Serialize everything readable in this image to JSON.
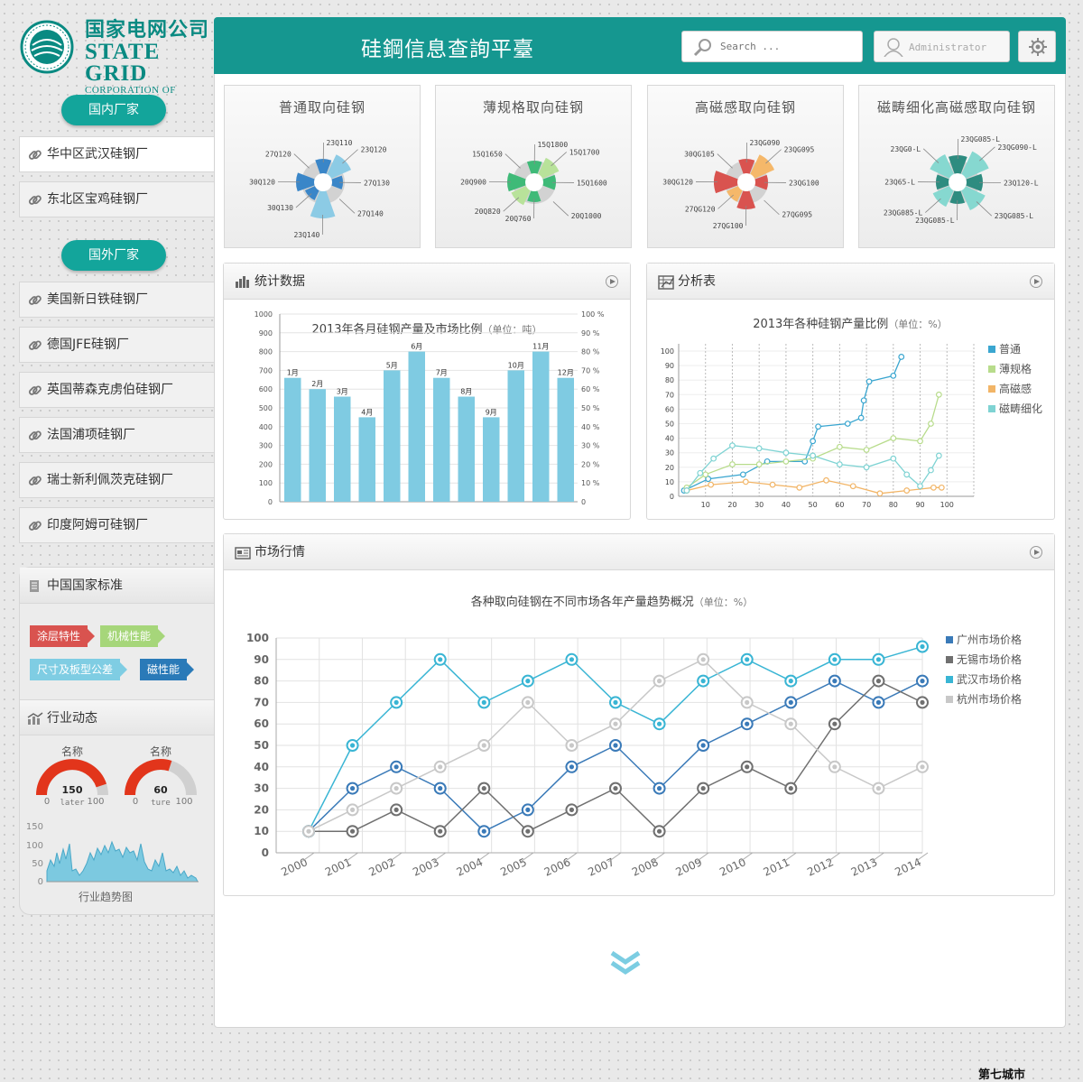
{
  "logo": {
    "cn": "国家电网公司",
    "en1": "STATE GRID",
    "en2": "CORPORATION OF CHINA"
  },
  "app": {
    "title": "硅鋼信息查詢平臺"
  },
  "header": {
    "search_placeholder": "Search ...",
    "user": "Administrator"
  },
  "sidebar": {
    "domestic_label": "国内厂家",
    "domestic": [
      {
        "label": "华中区武汉硅钢厂"
      },
      {
        "label": "东北区宝鸡硅钢厂"
      }
    ],
    "foreign_label": "国外厂家",
    "foreign": [
      {
        "label": "美国新日铁硅钢厂"
      },
      {
        "label": "德国JFE硅钢厂"
      },
      {
        "label": "英国蒂森克虏伯硅钢厂"
      },
      {
        "label": "法国浦项硅钢厂"
      },
      {
        "label": "瑞士新利佩茨克硅钢厂"
      },
      {
        "label": "印度阿姆可硅钢厂"
      }
    ],
    "standards_title": "中国国家标准",
    "tags": [
      {
        "label": "涂层特性",
        "color": "#d9534f"
      },
      {
        "label": "机械性能",
        "color": "#a6d67a"
      },
      {
        "label": "尺寸及板型公差",
        "color": "#7fcde3"
      },
      {
        "label": "磁性能",
        "color": "#2a7ab8"
      }
    ],
    "news_title": "行业动态",
    "gauges": [
      {
        "name": "名称",
        "value": "150",
        "min": "0",
        "max": "100",
        "sub": "later",
        "fill": 0.9
      },
      {
        "name": "名称",
        "value": "60",
        "min": "0",
        "max": "100",
        "sub": "ture",
        "fill": 0.6
      }
    ],
    "mini_chart": {
      "label": "行业趋势图",
      "yticks": [
        "150",
        "100",
        "50",
        "0"
      ]
    }
  },
  "cards": [
    {
      "title": "普通取向硅钢",
      "color": "#3a86c8",
      "labels": [
        "23Q110",
        "23Q120",
        "27Q130",
        "27Q140",
        "23Q140",
        "30Q130",
        "30Q120",
        "27Q120"
      ]
    },
    {
      "title": "薄规格取向硅钢",
      "color": "#3fba78",
      "light": "#b8e29a",
      "labels": [
        "15Q1800",
        "15Q1700",
        "15Q1600",
        "20Q1000",
        "20Q760",
        "20Q820",
        "20Q900",
        "15Q1650"
      ]
    },
    {
      "title": "高磁感取向硅钢",
      "color": "#d9534f",
      "light": "#f5b86a",
      "labels": [
        "23QG090",
        "23QG095",
        "23QG100",
        "27QG095",
        "27QG100",
        "27QG120",
        "30QG120",
        "30QG105"
      ]
    },
    {
      "title": "磁畴细化高磁感取向硅钢",
      "color": "#2e8c80",
      "light": "#86d8d0",
      "labels": [
        "23QG085-L",
        "23QG090-L",
        "23Q120-L",
        "23QG085-L",
        "23QG085-L",
        "23QG085-L",
        "23Q65-L",
        "23QG0-L"
      ]
    }
  ],
  "stats_panel": {
    "title": "统计数据"
  },
  "analysis_panel": {
    "title": "分析表"
  },
  "market_panel": {
    "title": "市场行情"
  },
  "chart_data": [
    {
      "type": "bar",
      "title": "2013年各月硅钢产量及市场比例",
      "unit": "（单位：吨）",
      "categories": [
        "1月",
        "2月",
        "3月",
        "4月",
        "5月",
        "6月",
        "7月",
        "8月",
        "9月",
        "10月",
        "11月",
        "12月"
      ],
      "values": [
        660,
        600,
        560,
        450,
        700,
        800,
        660,
        560,
        450,
        700,
        800,
        660
      ],
      "ylim": [
        0,
        1000
      ],
      "yticks": [
        "1000",
        "900",
        "800",
        "700",
        "600",
        "500",
        "400",
        "300",
        "200",
        "100",
        "0"
      ],
      "y2ticks": [
        "100 %",
        "90 %",
        "80 %",
        "70 %",
        "60 %",
        "50 %",
        "40 %",
        "30 %",
        "20 %",
        "10 %",
        "0"
      ],
      "color": "#7fcbe2"
    },
    {
      "type": "line",
      "title": "2013年各种硅钢产量比例",
      "unit": "（单位：%）",
      "xticks": [
        "10",
        "20",
        "30",
        "40",
        "50",
        "60",
        "70",
        "80",
        "90",
        "100"
      ],
      "yticks": [
        "100",
        "90",
        "80",
        "70",
        "60",
        "50",
        "40",
        "30",
        "20",
        "10",
        "0"
      ],
      "xlim": [
        0,
        110
      ],
      "ylim": [
        0,
        100
      ],
      "series": [
        {
          "name": "普通",
          "color": "#3aa6d0",
          "x": [
            2,
            11,
            24,
            33,
            47,
            50,
            52,
            63,
            68,
            69,
            71,
            80,
            83
          ],
          "y": [
            4,
            12,
            15,
            24,
            24,
            38,
            48,
            50,
            54,
            66,
            79,
            83,
            96
          ]
        },
        {
          "name": "薄规格",
          "color": "#b8dc8c",
          "x": [
            3,
            10,
            20,
            30,
            40,
            50,
            60,
            70,
            80,
            90,
            94,
            97
          ],
          "y": [
            6,
            15,
            22,
            22,
            24,
            26,
            34,
            32,
            40,
            38,
            50,
            70
          ]
        },
        {
          "name": "高磁感",
          "color": "#f2b567",
          "x": [
            3,
            12,
            25,
            35,
            45,
            55,
            65,
            75,
            85,
            95,
            98
          ],
          "y": [
            4,
            8,
            10,
            8,
            6,
            11,
            7,
            2,
            4,
            6,
            6
          ]
        },
        {
          "name": "磁畴细化",
          "color": "#7fd3d3",
          "x": [
            3,
            8,
            13,
            20,
            30,
            40,
            50,
            60,
            70,
            80,
            85,
            90,
            94,
            97
          ],
          "y": [
            4,
            16,
            26,
            35,
            33,
            30,
            28,
            22,
            20,
            26,
            15,
            7,
            18,
            28
          ]
        }
      ]
    },
    {
      "type": "line",
      "title": "各种取向硅钢在不同市场各年产量趋势概况",
      "unit": "（单位：%）",
      "categories": [
        "2000",
        "2001",
        "2002",
        "2003",
        "2004",
        "2005",
        "2006",
        "2007",
        "2008",
        "2009",
        "2010",
        "2011",
        "2012",
        "2013",
        "2014"
      ],
      "yticks": [
        "100",
        "90",
        "80",
        "70",
        "60",
        "50",
        "40",
        "30",
        "20",
        "10",
        "0"
      ],
      "ylim": [
        0,
        100
      ],
      "series": [
        {
          "name": "广州市场价格",
          "color": "#3a7ab8",
          "values": [
            10,
            30,
            40,
            30,
            10,
            20,
            40,
            50,
            30,
            50,
            60,
            70,
            80,
            70,
            80
          ]
        },
        {
          "name": "无锡市场价格",
          "color": "#707070",
          "values": [
            10,
            10,
            20,
            10,
            30,
            10,
            20,
            30,
            10,
            30,
            40,
            30,
            60,
            80,
            70
          ]
        },
        {
          "name": "武汉市场价格",
          "color": "#39b5d4",
          "values": [
            10,
            50,
            70,
            90,
            70,
            80,
            90,
            70,
            60,
            80,
            90,
            80,
            90,
            90,
            96
          ]
        },
        {
          "name": "杭州市场价格",
          "color": "#c8c8c8",
          "values": [
            10,
            20,
            30,
            40,
            50,
            70,
            50,
            60,
            80,
            90,
            70,
            60,
            40,
            30,
            40
          ]
        }
      ]
    }
  ],
  "watermark": "第七城市"
}
